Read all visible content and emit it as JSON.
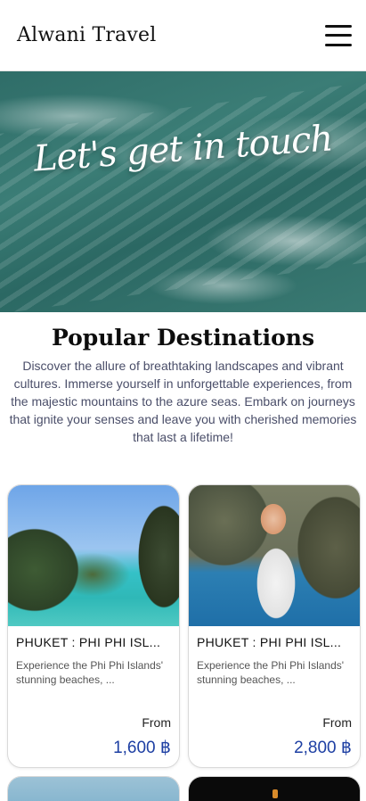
{
  "header": {
    "brand": "Alwani Travel",
    "menu_icon": "hamburger-menu-icon"
  },
  "hero": {
    "title": "Let's get in touch"
  },
  "section": {
    "title": "Popular Destinations",
    "description": "Discover the allure of breathtaking landscapes and vibrant cultures. Immerse yourself in unforgettable experiences, from the majestic mountains to the azure seas. Embark on journeys that ignite your senses and leave you with cherished memories that last a lifetime!"
  },
  "cards": [
    {
      "name": "PHUKET : PHI PHI ISL...",
      "description": "Experience the Phi Phi Islands' stunning beaches, ...",
      "from_label": "From",
      "price": "1,600 ฿"
    },
    {
      "name": "PHUKET : PHI PHI ISL...",
      "description": "Experience the Phi Phi Islands' stunning beaches, ...",
      "from_label": "From",
      "price": "2,800 ฿"
    }
  ],
  "colors": {
    "price": "#1d3fa3",
    "description": "#4a4e69"
  }
}
